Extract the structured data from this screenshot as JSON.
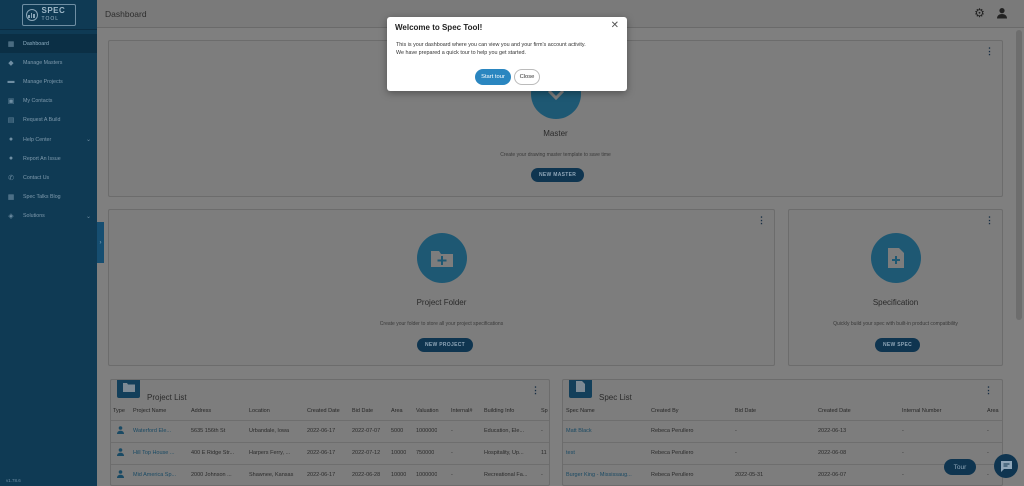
{
  "app": {
    "logo_top": "SPEC",
    "logo_bottom": "TOOL",
    "version": "v1.78.6"
  },
  "header": {
    "title": "Dashboard",
    "settings_icon": "gear-icon",
    "user_icon": "user-icon"
  },
  "sidebar": {
    "items": [
      {
        "label": "Dashboard",
        "icon": "grid-icon"
      },
      {
        "label": "Manage Masters",
        "icon": "layers-icon"
      },
      {
        "label": "Manage Projects",
        "icon": "folder-icon"
      },
      {
        "label": "My Contacts",
        "icon": "contacts-icon"
      },
      {
        "label": "Request A Build",
        "icon": "document-icon"
      },
      {
        "label": "Help Center",
        "icon": "help-icon"
      },
      {
        "label": "Report An Issue",
        "icon": "alert-icon"
      },
      {
        "label": "Contact Us",
        "icon": "phone-icon"
      },
      {
        "label": "Spec Talks Blog",
        "icon": "blog-icon"
      },
      {
        "label": "Solutions",
        "icon": "tag-icon"
      }
    ]
  },
  "cards": {
    "master": {
      "title": "Master",
      "description": "Create your drawing master template to save time",
      "button": "NEW MASTER"
    },
    "project_folder": {
      "title": "Project Folder",
      "description": "Create your folder to store all your project specifications",
      "button": "NEW PROJECT"
    },
    "specification": {
      "title": "Specification",
      "description": "Quickly build your spec with built-in product compatibility",
      "button": "NEW SPEC"
    }
  },
  "project_list": {
    "title": "Project List",
    "columns": [
      "Type",
      "Project Name",
      "Address",
      "Location",
      "Created Date",
      "Bid Date",
      "Area",
      "Valuation",
      "Internal#",
      "Building Info",
      "Sp"
    ],
    "rows": [
      [
        "Waterford Ele...",
        "5635 156th St",
        "Urbandale, Iowa",
        "2022-06-17",
        "2022-07-07",
        "5000",
        "1000000",
        "-",
        "Education, Ele...",
        "-"
      ],
      [
        "Hill Top House ...",
        "400 E Ridge Str...",
        "Harpers Ferry, ...",
        "2022-06-17",
        "2022-07-12",
        "10000",
        "750000",
        "-",
        "Hospitality, Up...",
        "11"
      ],
      [
        "Mid America Sp...",
        "2000 Johnson ...",
        "Shawnee, Kansas",
        "2022-06-17",
        "2022-06-28",
        "10000",
        "1000000",
        "-",
        "Recreational Fa...",
        "-"
      ]
    ]
  },
  "spec_list": {
    "title": "Spec List",
    "columns": [
      "Spec Name",
      "Created By",
      "Bid Date",
      "Created Date",
      "Internal Number",
      "Area"
    ],
    "rows": [
      [
        "Matt Black",
        "Rebeca Perullero",
        "-",
        "2022-06-13",
        "-",
        "-"
      ],
      [
        "test",
        "Rebeca Perullero",
        "-",
        "2022-06-08",
        "-",
        "-"
      ],
      [
        "Burger King - Mississaug...",
        "Rebeca Perullero",
        "2022-05-31",
        "2022-06-07",
        "-",
        "-"
      ]
    ]
  },
  "tour_button": "Tour",
  "modal": {
    "title": "Welcome to Spec Tool!",
    "line1": "This is your dashboard where you can view you and your firm's account activity.",
    "line2": "We have prepared a quick tour to help you get started.",
    "start_label": "Start tour",
    "close_label": "Close"
  },
  "colors": {
    "sidebar": "#0f3a54",
    "accent": "#2a86c0",
    "overlay": "#7f7f7f"
  }
}
